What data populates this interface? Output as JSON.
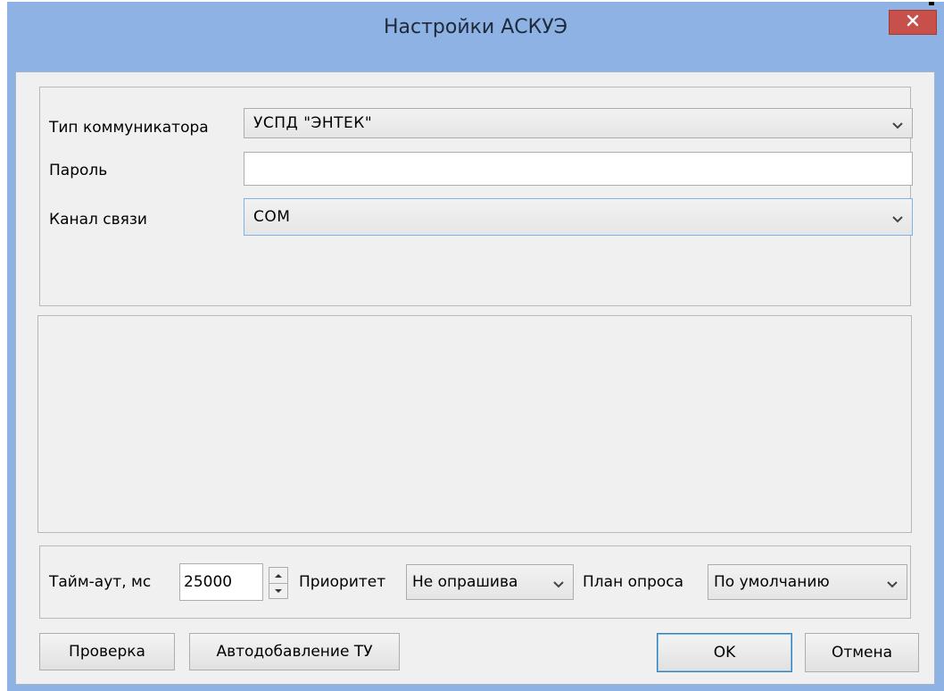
{
  "window": {
    "title": "Настройки АСКУЭ",
    "close_icon": "close-icon"
  },
  "form": {
    "communicator_label": "Тип коммуникатора",
    "communicator_value": "УСПД \"ЭНТЕК\"",
    "password_label": "Пароль",
    "password_value": "",
    "channel_label": "Канал связи",
    "channel_value": "COM"
  },
  "bottom_bar": {
    "timeout_label": "Тайм-аут, мс",
    "timeout_value": "25000",
    "priority_label": "Приоритет",
    "priority_value": "Не опрашива",
    "plan_label": "План опроса",
    "plan_value": "По умолчанию"
  },
  "buttons": {
    "check": "Проверка",
    "autoadd": "Автодобавление ТУ",
    "ok": "OK",
    "cancel": "Отмена"
  },
  "colors": {
    "frame": "#8db2e3",
    "close": "#c7504a",
    "client": "#f0f0f0",
    "focus_border": "#7eb4ea"
  }
}
